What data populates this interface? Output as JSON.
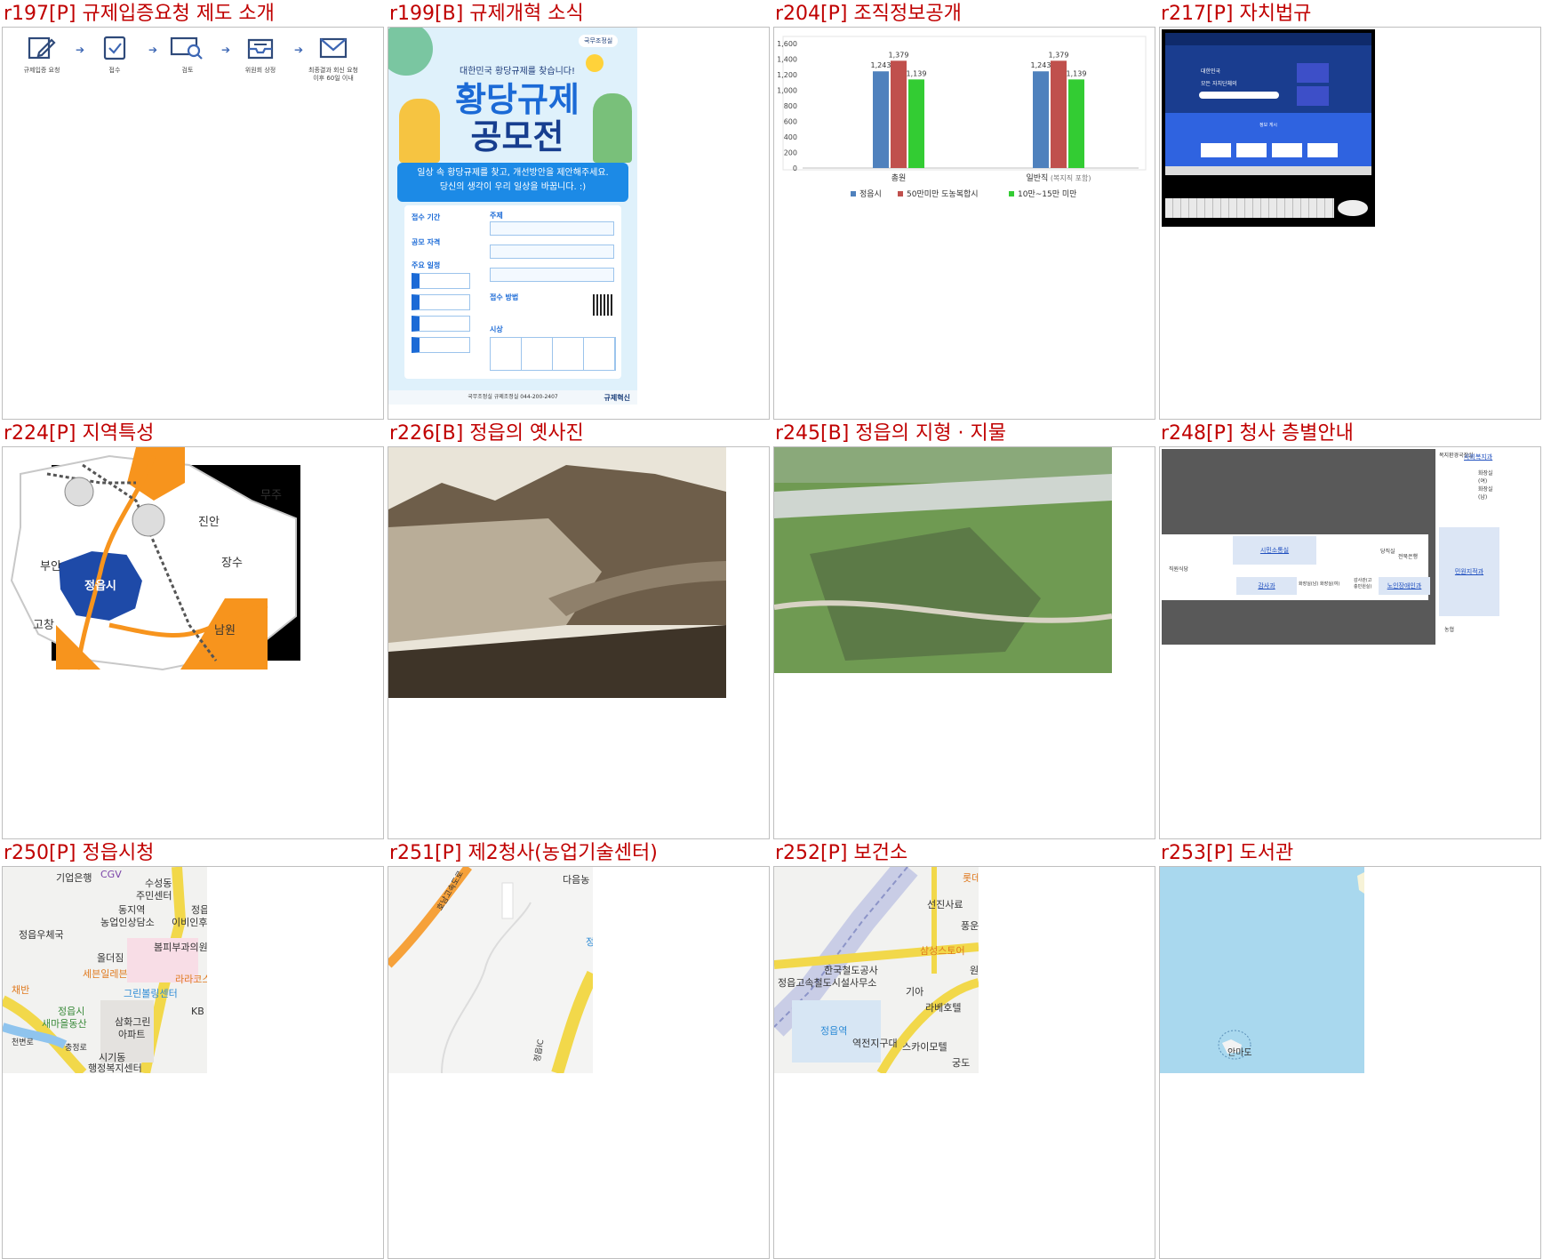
{
  "cells": [
    {
      "title": "r197[P] 규제입증요청 제도 소개"
    },
    {
      "title": "r199[B] 규제개혁 소식"
    },
    {
      "title": "r204[P] 조직정보공개"
    },
    {
      "title": "r217[P] 자치법규"
    },
    {
      "title": "r224[P] 지역특성"
    },
    {
      "title": "r226[B] 정읍의 옛사진"
    },
    {
      "title": "r245[B] 정읍의 지형 · 지물"
    },
    {
      "title": "r248[P] 청사 층별안내"
    },
    {
      "title": "r250[P] 정읍시청"
    },
    {
      "title": "r251[P] 제2청사(농업기술센터)"
    },
    {
      "title": "r252[P] 보건소"
    },
    {
      "title": "r253[P] 도서관"
    }
  ],
  "process": {
    "steps": [
      {
        "label": "규제입증 요청",
        "icon": "edit-icon"
      },
      {
        "label": "접수",
        "icon": "clipboard-check-icon"
      },
      {
        "label": "검토",
        "icon": "search-card-icon"
      },
      {
        "label": "위원회 상정",
        "icon": "inbox-icon"
      },
      {
        "label": "최종결과 회신 요청 이후 60일 이내",
        "icon": "mail-icon"
      }
    ]
  },
  "poster": {
    "org": "국무조정실",
    "headline": "대한민국 황당규제를 찾습니다!",
    "title_line1": "황당규제",
    "title_line2": "공모전",
    "banner_line1": "일상 속 황당규제를 찾고, 개선방안을 제안해주세요.",
    "banner_line2": "당신의 생각이 우리 일상을 바꿉니다. :)",
    "left_items": [
      "접수 기간",
      "공모 자격",
      "주요 일정"
    ],
    "right_items": [
      "주제",
      "접수 방법",
      "시상"
    ],
    "footer": "국무조정실 규제조정실 044-200-2407",
    "brand": "규제혁신"
  },
  "chart_data": {
    "type": "bar",
    "categories": [
      "총원",
      "일반직"
    ],
    "category_notes": [
      "",
      "(복지직 포함)"
    ],
    "series": [
      {
        "name": "정읍시",
        "values": [
          1243,
          1243
        ],
        "color": "#4f81bd"
      },
      {
        "name": "50만미만 도농복합시",
        "values": [
          1379,
          1379
        ],
        "color": "#c0504d"
      },
      {
        "name": "10만~15만 미만",
        "values": [
          1139,
          1139
        ],
        "color": "#33cc33"
      }
    ],
    "value_labels": [
      "1,243",
      "1,379",
      "1,139"
    ],
    "ylim": [
      0,
      1600
    ],
    "yticks": [
      "0",
      "200",
      "400",
      "600",
      "800",
      "1,000",
      "1,200",
      "1,400",
      "1,600"
    ],
    "legend": "bottom"
  },
  "monitor": {
    "hero_line1": "대한민국",
    "hero_line2": "모든 자치단체의",
    "section": "정보 게시"
  },
  "region": {
    "labels": [
      "무주",
      "진안",
      "부안",
      "정읍시",
      "장수",
      "고창",
      "남원"
    ]
  },
  "floorplan": {
    "labels": [
      "복지환경국장실",
      "사회복지과",
      "화장실(여)",
      "화장실(남)",
      "시민소통실",
      "당직실",
      "전북은행",
      "민원지적과",
      "직원식당",
      "감사과",
      "화장실(남)",
      "화장실(여)",
      "감사관(고충민원실)",
      "노인장애인과",
      "농협"
    ]
  },
  "map250": {
    "labels": [
      "CGV",
      "기업은행",
      "수성동",
      "주민센터",
      "동지역",
      "농업인상담소",
      "정읍",
      "이비인후과",
      "정읍우체국",
      "봄피부과의원",
      "올더짐",
      "세븐일레븐",
      "라라코스",
      "채반",
      "그린볼링센터",
      "정읍시",
      "새마을동산",
      "삼화그린",
      "아파트",
      "KB",
      "시기동",
      "행정복지센터",
      "천변로",
      "충정로"
    ]
  },
  "map251": {
    "labels": [
      "다음농",
      "호남고속도로",
      "정",
      "정읍IC"
    ]
  },
  "map252": {
    "labels": [
      "롯데",
      "선진사료",
      "풍운",
      "삼성스토어",
      "원",
      "한국철도공사",
      "정읍고속철도시설사무소",
      "기아",
      "라베호텔",
      "정읍역",
      "역전지구대",
      "스카이모텔",
      "궁도"
    ]
  },
  "map253": {
    "labels": [
      "안마도"
    ]
  }
}
